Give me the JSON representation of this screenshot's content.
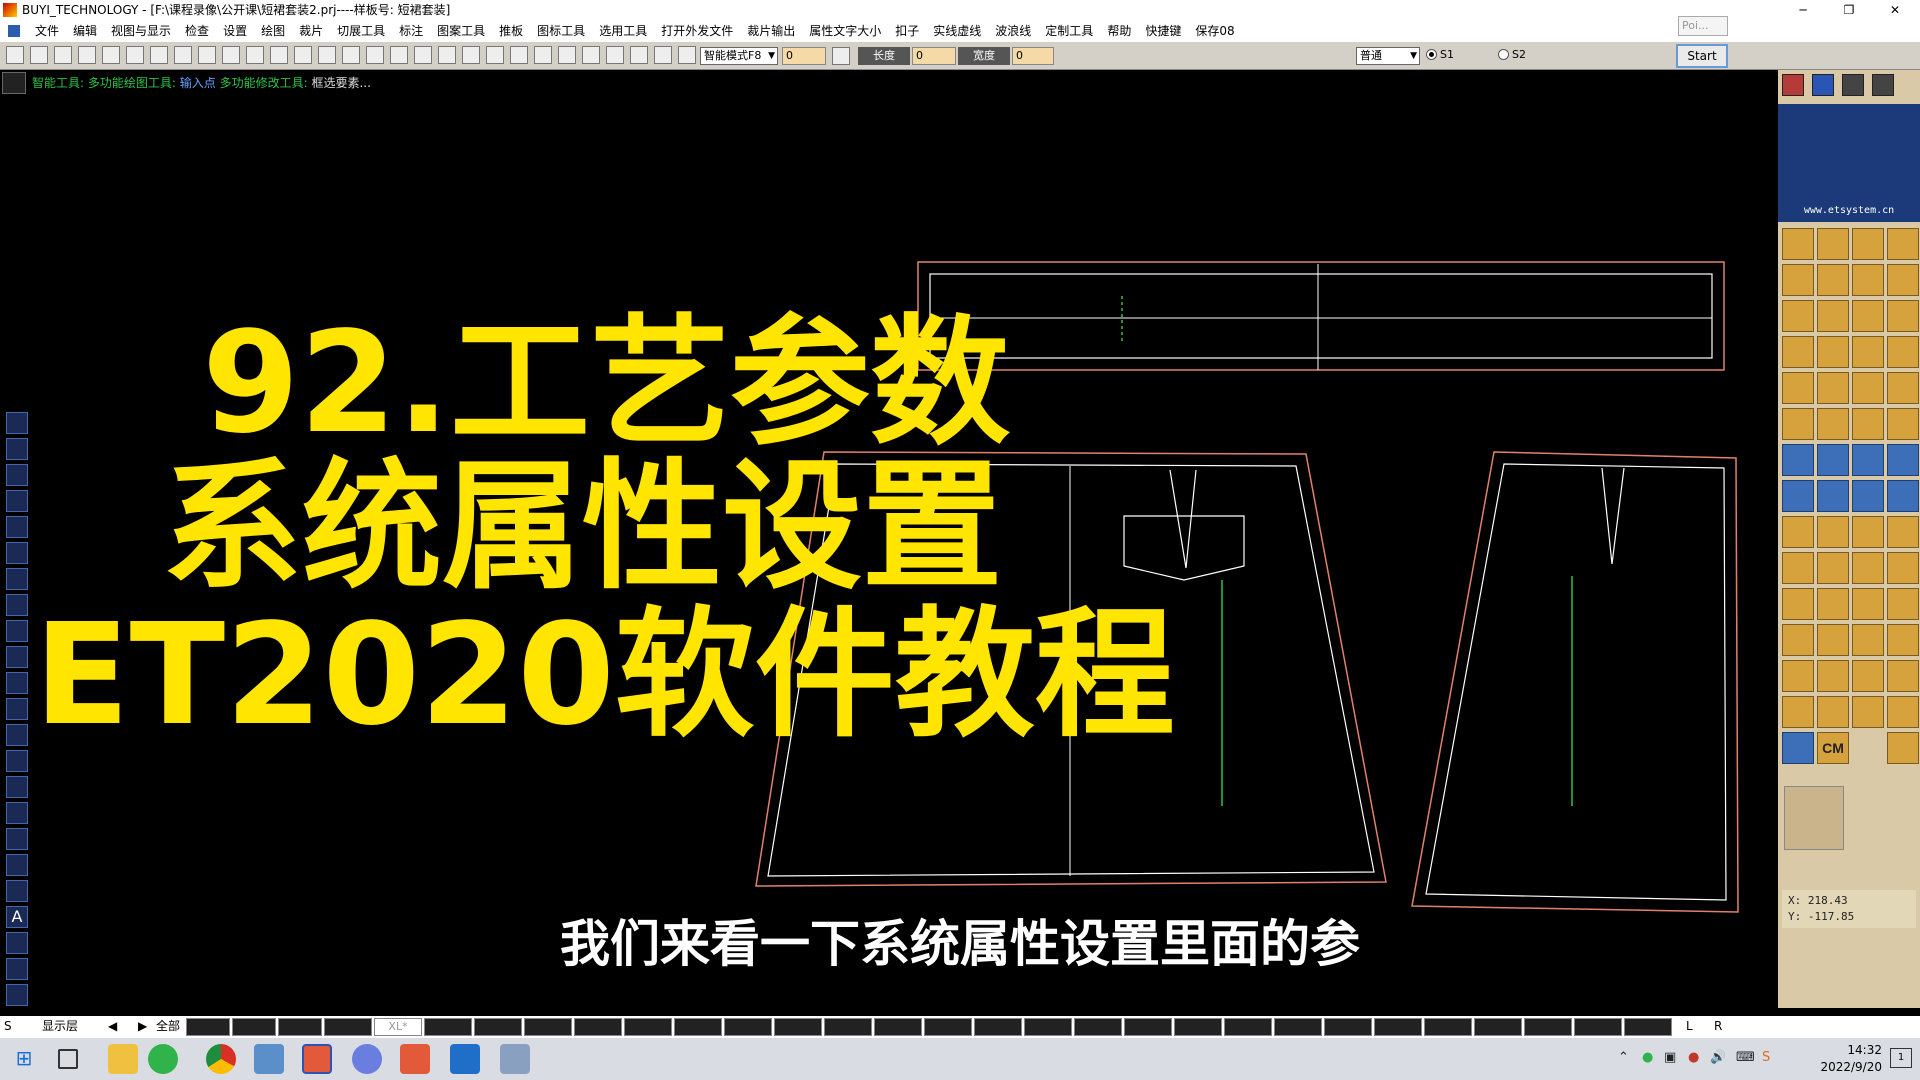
{
  "window": {
    "title": "BUYI_TECHNOLOGY - [F:\\课程录像\\公开课\\短裙套装2.prj----样板号: 短裙套装]",
    "minimize": "─",
    "maximize": "❐",
    "close": "✕"
  },
  "menu": {
    "items": [
      "文件",
      "编辑",
      "视图与显示",
      "检查",
      "设置",
      "绘图",
      "裁片",
      "切展工具",
      "标注",
      "图案工具",
      "推板",
      "图标工具",
      "选用工具",
      "打开外发文件",
      "裁片输出",
      "属性文字大小",
      "扣子",
      "实线虚线",
      "波浪线",
      "定制工具",
      "帮助",
      "快捷键",
      "保存08"
    ],
    "poi_placeholder": "Poi..."
  },
  "toolbar": {
    "mode_select": "智能模式F8",
    "input_one": "0",
    "length_label": "长度",
    "length_value": "0",
    "width_label": "宽度",
    "width_value": "0",
    "line_style_select": "普通",
    "radio_s1": "S1",
    "radio_s2": "S2",
    "start_label": "Start"
  },
  "toolrow": {
    "crumb1": "智能工具:",
    "crumb2": "多功能绘图工具:",
    "crumb3": "输入点",
    "crumb4": "多功能修改工具:",
    "crumb5": "框选要素..."
  },
  "right_panel": {
    "url": "www.etsystem.cn",
    "cm_label": "CM",
    "coord_x": "X:  218.43",
    "coord_y": "Y:  -117.85"
  },
  "overlay": {
    "line1": "92.工艺参数",
    "line2": "系统属性设置",
    "line3": "ET2020软件教程",
    "subtitle": "我们来看一下系统属性设置里面的参"
  },
  "sizebar": {
    "s_label": "S",
    "layer_label": "显示层",
    "prev_arrow": "◀",
    "next_arrow": "▶",
    "all_label": "全部",
    "size_xl": "XL*",
    "l_label": "L",
    "r_label": "R"
  },
  "taskbar": {
    "time": "14:32",
    "date": "2022/9/20",
    "notification_count": "1"
  },
  "colors": {
    "overlay_yellow": "#ffe500",
    "pattern_outline": "#e0826a",
    "pattern_inner": "#ffffff",
    "grain_line": "#2ec24a"
  }
}
